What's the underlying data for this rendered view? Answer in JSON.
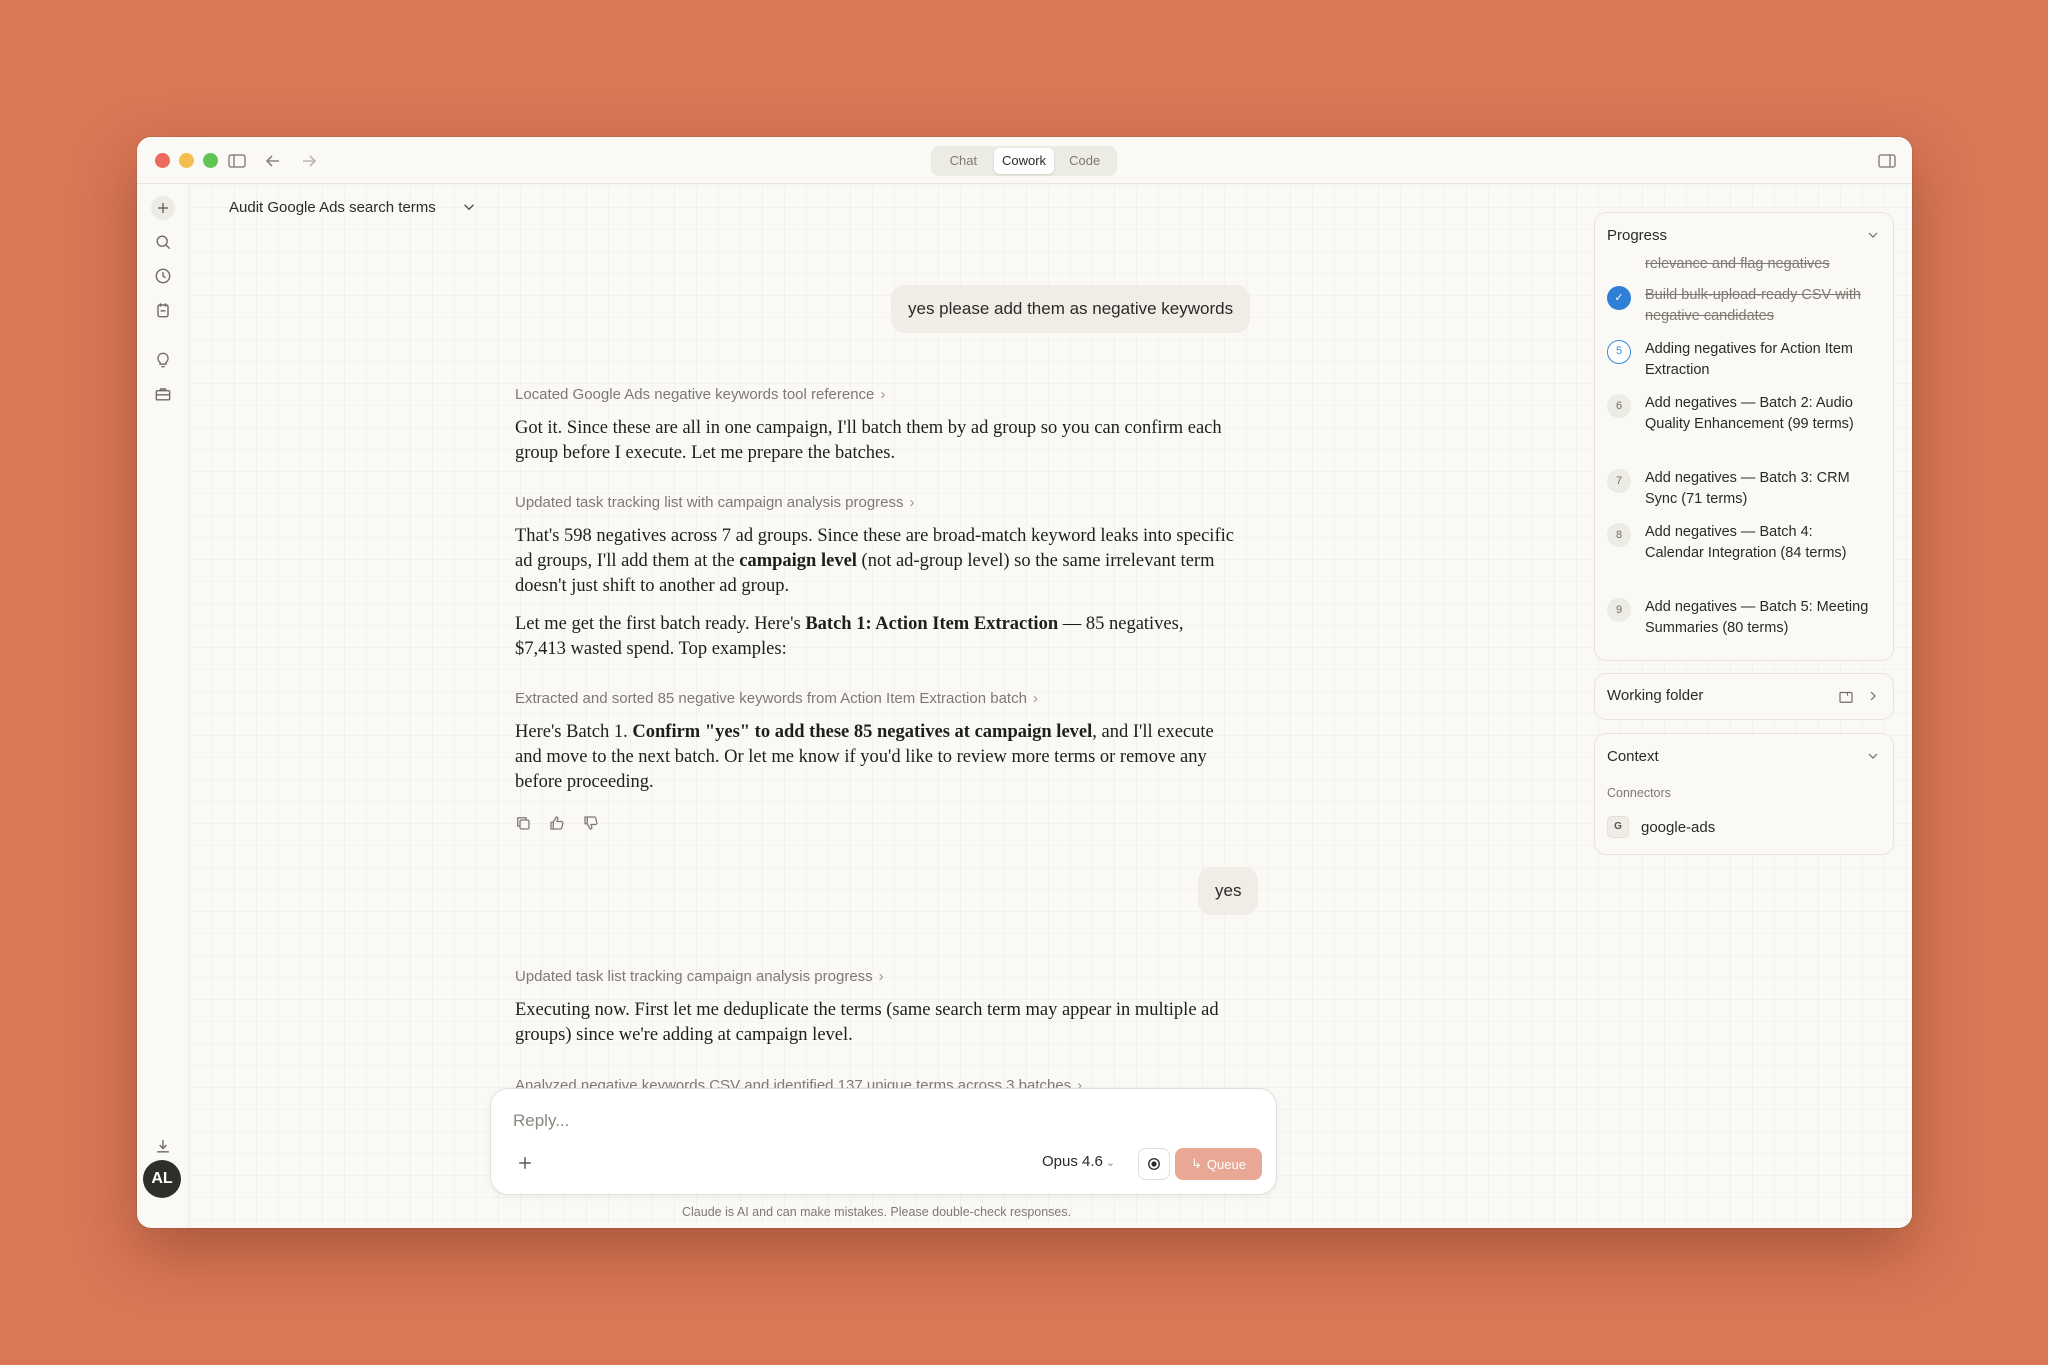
{
  "window": {
    "modes": [
      "Chat",
      "Cowork",
      "Code"
    ],
    "active_mode": "Cowork"
  },
  "conversation": {
    "title": "Audit Google Ads search terms",
    "user_message_1": "yes please add them as negative keywords",
    "tool_1": "Located Google Ads negative keywords tool reference",
    "para_1": "Got it. Since these are all in one campaign, I'll batch them by ad group so you can confirm each group before I execute. Let me prepare the batches.",
    "tool_2": "Updated task tracking list with campaign analysis progress",
    "para_2": {
      "a": "That's 598 negatives across 7 ad groups. Since these are broad-match keyword leaks into specific ad groups, I'll add them at the ",
      "b": "campaign level",
      "c": " (not ad-group level) so the same irrelevant term doesn't just shift to another ad group."
    },
    "para_3": {
      "a": "Let me get the first batch ready. Here's ",
      "b": "Batch 1: Action Item Extraction",
      "c": " — 85 negatives, $7,413 wasted spend. Top examples:"
    },
    "tool_3": "Extracted and sorted 85 negative keywords from Action Item Extraction batch",
    "para_4": {
      "a": "Here's Batch 1. ",
      "b": "Confirm \"yes\" to add these 85 negatives at campaign level",
      "c": ", and I'll execute and move to the next batch. Or let me know if you'd like to review more terms or remove any before proceeding."
    },
    "user_message_2": "yes",
    "tool_4": "Updated task list tracking campaign analysis progress",
    "para_5": "Executing now. First let me deduplicate the terms (same search term may appear in multiple ad groups) since we're adding at campaign level.",
    "tool_5": "Analyzed negative keywords CSV and identified 137 unique terms across 3 batches"
  },
  "composer": {
    "placeholder": "Reply...",
    "model": "Opus 4.6",
    "queue_label": "Queue",
    "disclaimer": "Claude is AI and can make mistakes. Please double-check responses."
  },
  "sidebar": {
    "avatar_initials": "AL"
  },
  "progress": {
    "title": "Progress",
    "steps": [
      {
        "num": "",
        "text": "relevance and flag negatives",
        "state": "done"
      },
      {
        "num": "✓",
        "text": "Build bulk-upload-ready CSV with negative candidates",
        "state": "done"
      },
      {
        "num": "5",
        "text": "Adding negatives for Action Item Extraction",
        "state": "current"
      },
      {
        "num": "6",
        "text": "Add negatives — Batch 2: Audio Quality Enhancement (99 terms)",
        "state": "pending"
      },
      {
        "num": "7",
        "text": "Add negatives — Batch 3: CRM Sync (71 terms)",
        "state": "pending"
      },
      {
        "num": "8",
        "text": "Add negatives — Batch 4: Calendar Integration (84 terms)",
        "state": "pending"
      },
      {
        "num": "9",
        "text": "Add negatives — Batch 5: Meeting Summaries (80 terms)",
        "state": "pending"
      }
    ]
  },
  "working_folder": {
    "title": "Working folder"
  },
  "context": {
    "title": "Context",
    "connectors_label": "Connectors",
    "connector_icon": "G",
    "connector_name": "google-ads"
  }
}
